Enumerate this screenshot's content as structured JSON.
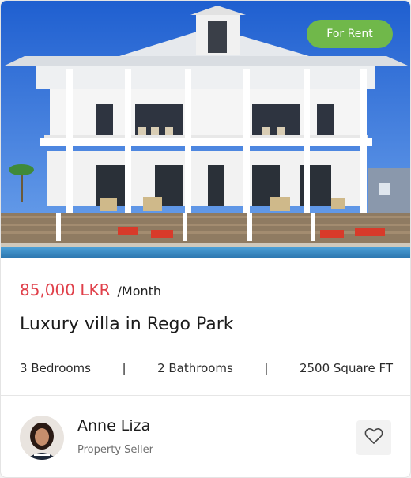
{
  "listing": {
    "status_badge": "For Rent",
    "price": "85,000 LKR",
    "period": "/Month",
    "title": "Luxury villa in Rego Park",
    "features": {
      "bedrooms": "3 Bedrooms",
      "bathrooms": "2 Bathrooms",
      "area": "2500 Square FT",
      "separator": "|"
    },
    "photo_icon": "villa-photo",
    "colors": {
      "badge": "#70b84a",
      "price": "#e0404a"
    }
  },
  "seller": {
    "name": "Anne Liza",
    "role": "Property Seller",
    "avatar_icon": "avatar"
  },
  "actions": {
    "favorite_icon": "heart-icon"
  }
}
